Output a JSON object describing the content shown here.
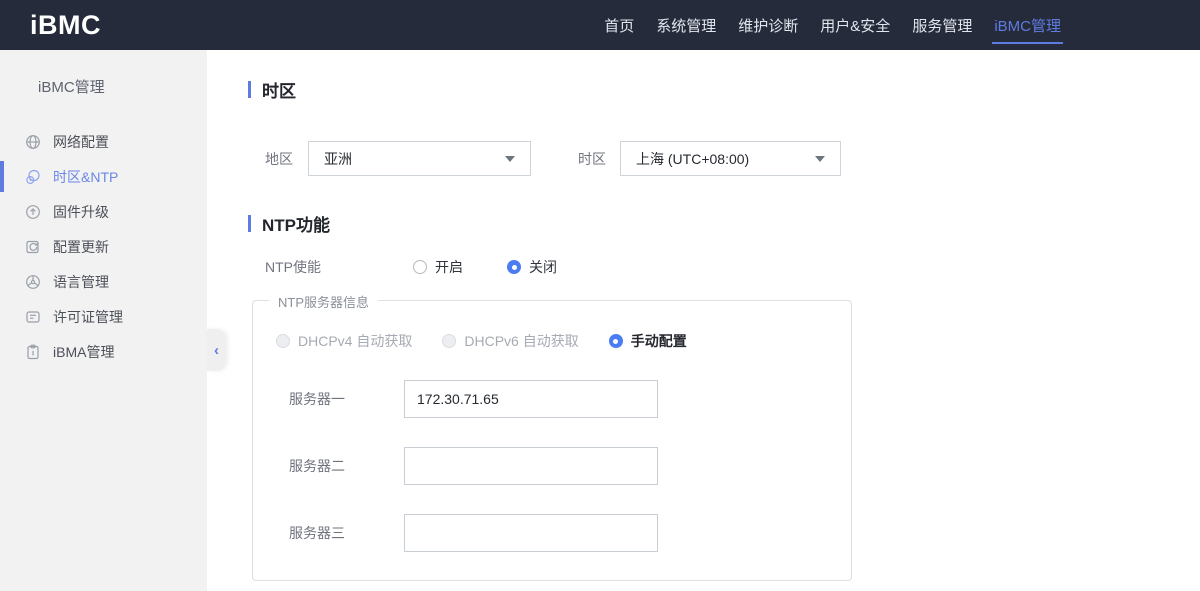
{
  "header": {
    "logo": "iBMC",
    "nav": [
      {
        "label": "首页",
        "active": false
      },
      {
        "label": "系统管理",
        "active": false
      },
      {
        "label": "维护诊断",
        "active": false
      },
      {
        "label": "用户&安全",
        "active": false
      },
      {
        "label": "服务管理",
        "active": false
      },
      {
        "label": "iBMC管理",
        "active": true
      }
    ]
  },
  "sidebar": {
    "title": "iBMC管理",
    "items": [
      {
        "label": "网络配置",
        "icon": "network-globe-icon",
        "active": false
      },
      {
        "label": "时区&NTP",
        "icon": "timezone-clock-icon",
        "active": true
      },
      {
        "label": "固件升级",
        "icon": "firmware-upgrade-icon",
        "active": false
      },
      {
        "label": "配置更新",
        "icon": "config-update-icon",
        "active": false
      },
      {
        "label": "语言管理",
        "icon": "language-icon",
        "active": false
      },
      {
        "label": "许可证管理",
        "icon": "license-icon",
        "active": false
      },
      {
        "label": "iBMA管理",
        "icon": "ibma-clipboard-icon",
        "active": false
      }
    ],
    "collapse_icon": "‹"
  },
  "main": {
    "timezone_section": {
      "title": "时区",
      "region_label": "地区",
      "region_value": "亚洲",
      "timezone_label": "时区",
      "timezone_value": "上海 (UTC+08:00)"
    },
    "ntp_section": {
      "title": "NTP功能",
      "enable_label": "NTP使能",
      "enable_options": [
        {
          "label": "开启",
          "selected": false
        },
        {
          "label": "关闭",
          "selected": true
        }
      ],
      "server_group": {
        "legend": "NTP服务器信息",
        "mode_options": [
          {
            "label": "DHCPv4 自动获取",
            "selected": false,
            "disabled": true
          },
          {
            "label": "DHCPv6 自动获取",
            "selected": false,
            "disabled": true
          },
          {
            "label": "手动配置",
            "selected": true,
            "disabled": false
          }
        ],
        "servers": [
          {
            "label": "服务器一",
            "value": "172.30.71.65"
          },
          {
            "label": "服务器二",
            "value": ""
          },
          {
            "label": "服务器三",
            "value": ""
          }
        ]
      }
    }
  },
  "colors": {
    "header_bg": "#252b3a",
    "accent": "#5e7ce0",
    "radio_selected": "#4b7cf2",
    "sidebar_bg": "#f2f2f2"
  }
}
